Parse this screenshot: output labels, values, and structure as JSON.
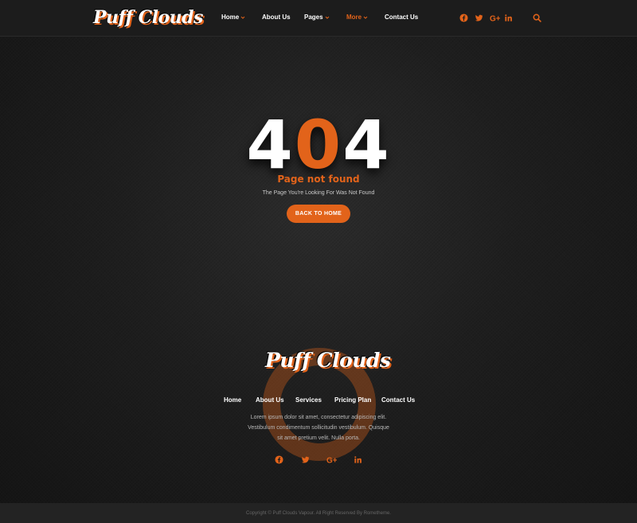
{
  "brand": {
    "logo_text": "Puff Clouds"
  },
  "header": {
    "nav": [
      {
        "label": "Home",
        "dropdown": true,
        "active": false
      },
      {
        "label": "About Us",
        "dropdown": false,
        "active": false
      },
      {
        "label": "Pages",
        "dropdown": true,
        "active": false
      },
      {
        "label": "More",
        "dropdown": true,
        "active": true
      },
      {
        "label": "Contact Us",
        "dropdown": false,
        "active": false
      }
    ],
    "social": [
      "facebook-icon",
      "twitter-icon",
      "google-plus-icon",
      "linkedin-icon"
    ],
    "search_icon": "search-icon"
  },
  "error": {
    "code_left": "4",
    "code_mid": "0",
    "code_right": "4",
    "title": "Page not found",
    "subtitle": "The Page You're Looking For Was Not Found",
    "button_label": "BACK TO HOME"
  },
  "footer": {
    "logo_text": "Puff Clouds",
    "nav": [
      "Home",
      "About Us",
      "Services",
      "Pricing Plan",
      "Contact Us"
    ],
    "text_line1": "Lorem ipsum dolor sit amet, consectetur adipiscing elit.",
    "text_line2": "Vestibulum condimentum sollicitudin vestibulum. Quisque",
    "text_line3": "sit amet pretium velit. Nulla porta.",
    "social": [
      "facebook-icon",
      "twitter-icon",
      "google-plus-icon",
      "linkedin-icon"
    ],
    "copyright": "Copyright © Puff Clouds Vapour. All Right Reserved By Rometheme."
  },
  "colors": {
    "accent": "#e2631a",
    "background": "#1a1a1a",
    "header_bg": "#1c1c1c",
    "text": "#ffffff"
  }
}
